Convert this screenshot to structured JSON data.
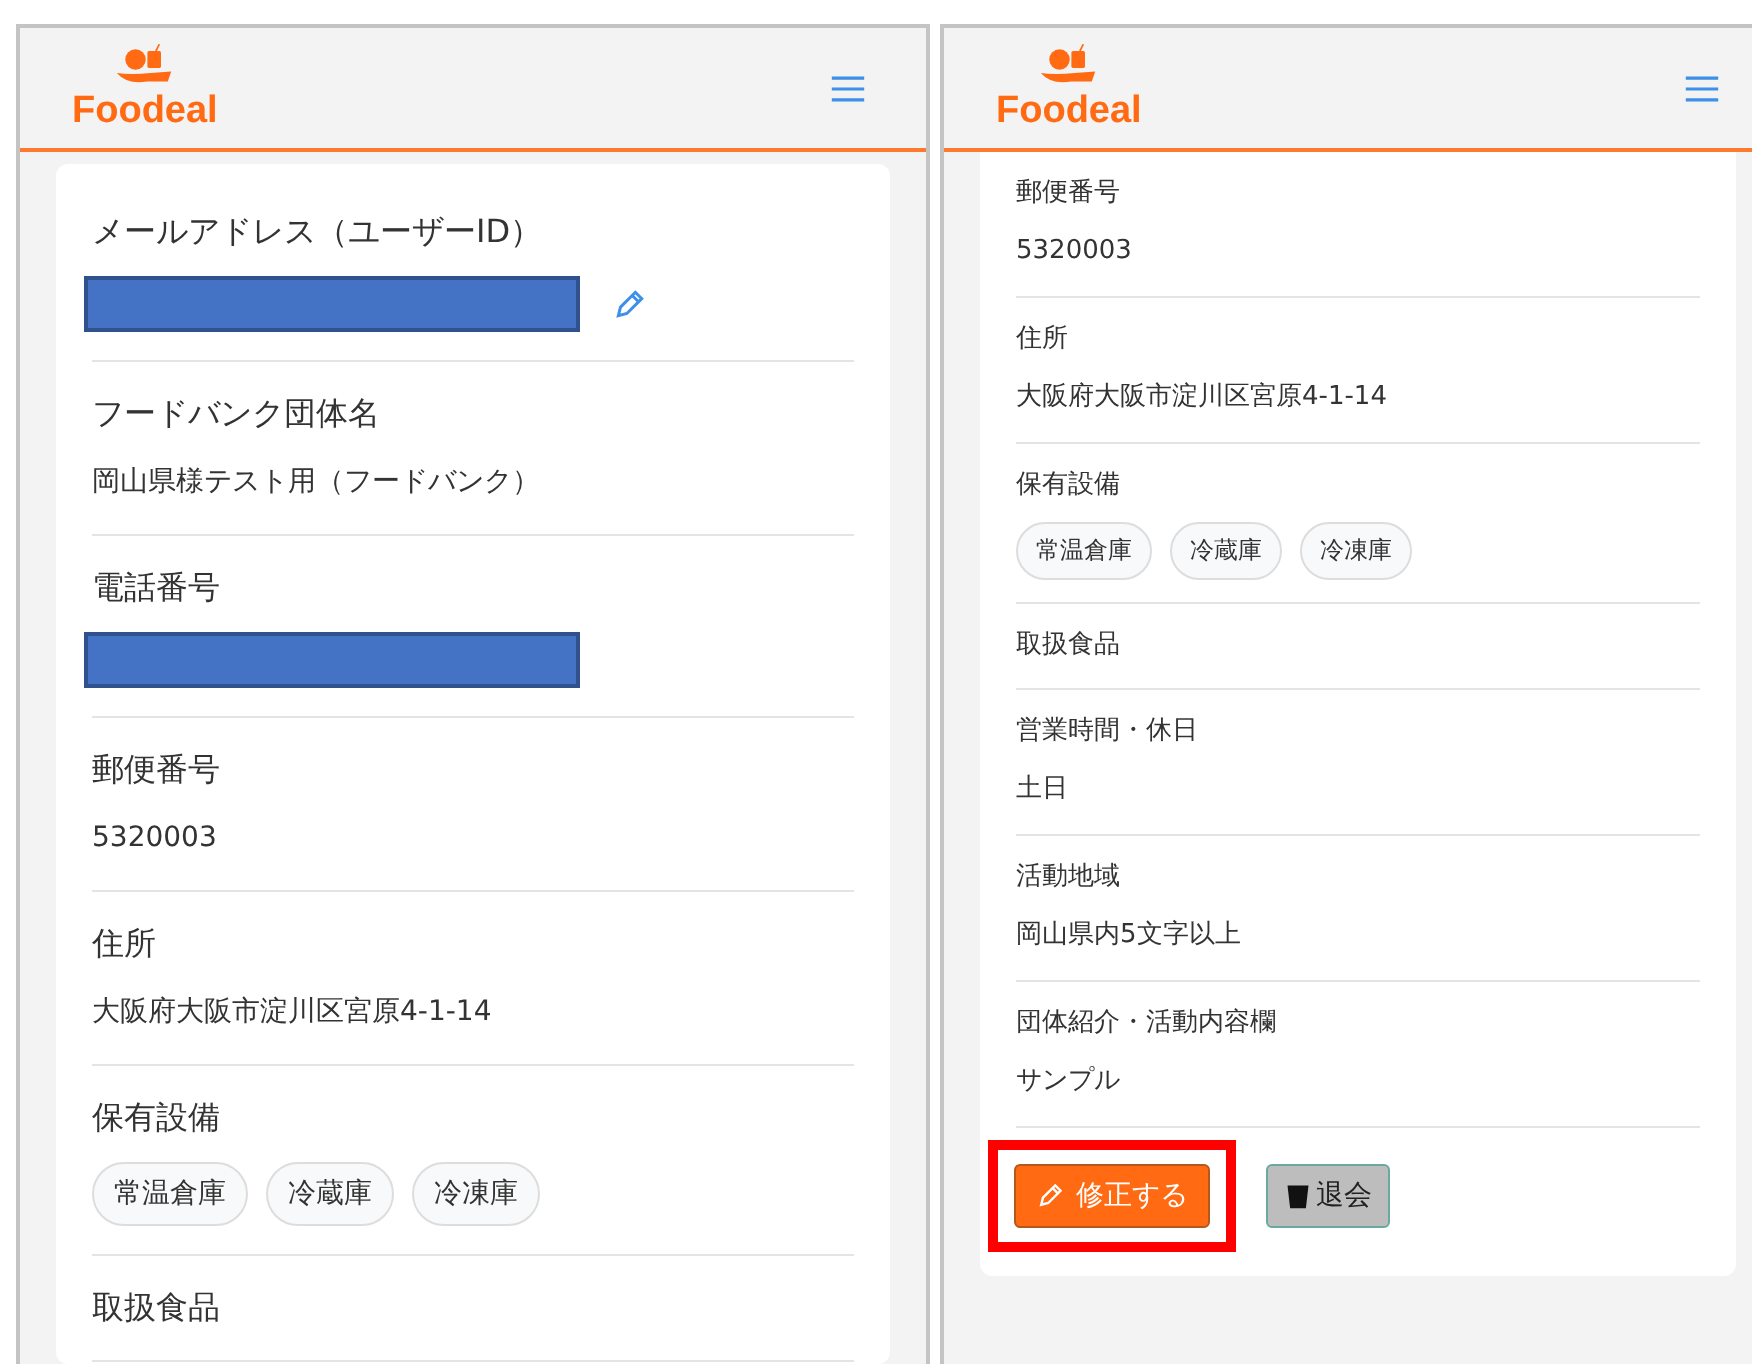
{
  "screens": [
    {
      "logo": "Foodeal",
      "fields": [
        {
          "kind": "redacted",
          "label": "メールアドレス（ユーザーID）",
          "editable": true
        },
        {
          "kind": "text",
          "label": "フードバンク団体名",
          "value": "岡山県様テスト用（フードバンク）"
        },
        {
          "kind": "redacted",
          "label": "電話番号"
        },
        {
          "kind": "text",
          "label": "郵便番号",
          "value": "5320003"
        },
        {
          "kind": "text",
          "label": "住所",
          "value": "大阪府大阪市淀川区宮原4-1-14"
        },
        {
          "kind": "chips",
          "label": "保有設備",
          "chips": [
            "常温倉庫",
            "冷蔵庫",
            "冷凍庫"
          ]
        },
        {
          "kind": "empty",
          "label": "取扱食品"
        }
      ]
    },
    {
      "logo": "Foodeal",
      "fields": [
        {
          "kind": "text",
          "label": "郵便番号",
          "value": "5320003"
        },
        {
          "kind": "text",
          "label": "住所",
          "value": "大阪府大阪市淀川区宮原4-1-14"
        },
        {
          "kind": "chips",
          "label": "保有設備",
          "chips": [
            "常温倉庫",
            "冷蔵庫",
            "冷凍庫"
          ]
        },
        {
          "kind": "empty",
          "label": "取扱食品"
        },
        {
          "kind": "text",
          "label": "営業時間・休日",
          "value": "土日"
        },
        {
          "kind": "text",
          "label": "活動地域",
          "value": "岡山県内5文字以上"
        },
        {
          "kind": "text",
          "label": "団体紹介・活動内容欄",
          "value": "サンプル"
        }
      ],
      "buttons": [
        {
          "kind": "edit",
          "label": "修正する",
          "highlighted": true
        },
        {
          "kind": "withdraw",
          "label": "退会",
          "highlighted": false
        }
      ]
    }
  ]
}
